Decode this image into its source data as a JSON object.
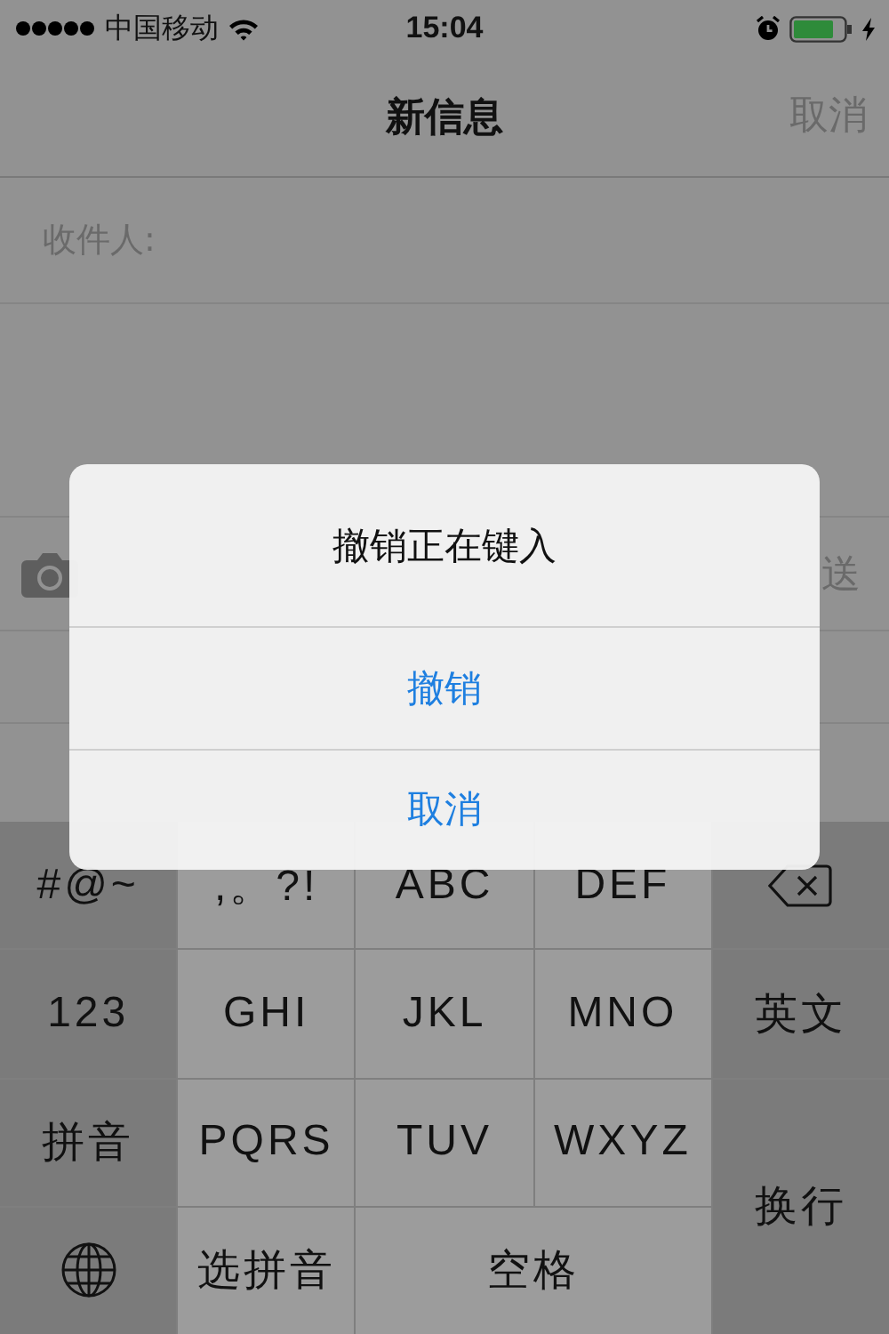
{
  "status_bar": {
    "carrier": "中国移动",
    "time": "15:04"
  },
  "nav_bar": {
    "title": "新信息",
    "cancel": "取消"
  },
  "recipient": {
    "label": "收件人:"
  },
  "composer": {
    "send": "送"
  },
  "dialog": {
    "title": "撤销正在键入",
    "buttons": [
      {
        "label": "撤销"
      },
      {
        "label": "取消"
      }
    ]
  },
  "keyboard": {
    "keys": [
      {
        "kind": "function",
        "label": "#@~"
      },
      {
        "kind": "letter",
        "label": ",。?!"
      },
      {
        "kind": "letter",
        "label": "ABC"
      },
      {
        "kind": "letter",
        "label": "DEF"
      },
      {
        "kind": "delete"
      },
      {
        "kind": "function",
        "label": "123"
      },
      {
        "kind": "letter",
        "label": "GHI"
      },
      {
        "kind": "letter",
        "label": "JKL"
      },
      {
        "kind": "letter",
        "label": "MNO"
      },
      {
        "kind": "function",
        "label": "英文"
      },
      {
        "kind": "function",
        "label": "拼音"
      },
      {
        "kind": "letter",
        "label": "PQRS"
      },
      {
        "kind": "letter",
        "label": "TUV"
      },
      {
        "kind": "letter",
        "label": "WXYZ"
      },
      {
        "kind": "return",
        "label": "换行"
      },
      {
        "kind": "globe"
      },
      {
        "kind": "letter",
        "label": "选拼音"
      },
      {
        "kind": "space",
        "label": "空格"
      }
    ]
  }
}
